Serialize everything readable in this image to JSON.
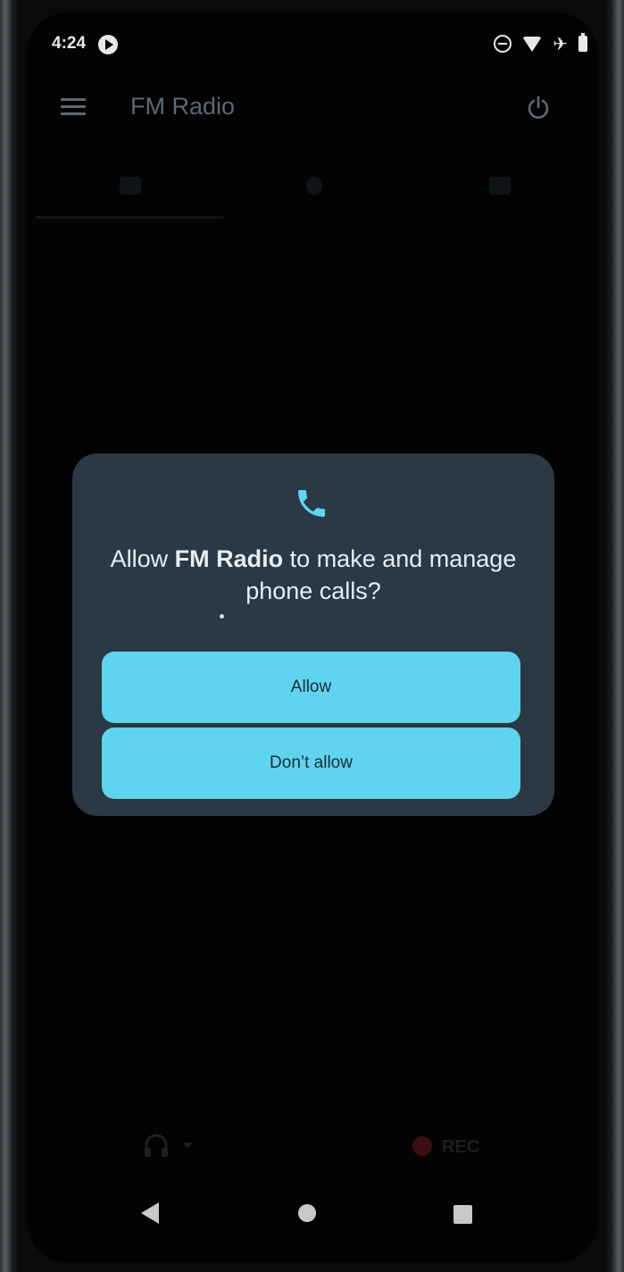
{
  "status_bar": {
    "time": "4:24",
    "icons": [
      "media-play-icon",
      "do-not-disturb-icon",
      "wifi-icon",
      "airplane-mode-icon",
      "battery-icon"
    ]
  },
  "app_bar": {
    "title": "FM Radio",
    "icons": [
      "menu-icon",
      "power-icon"
    ]
  },
  "dialog": {
    "icon": "phone-icon",
    "title_prefix": "Allow ",
    "title_app": "FM Radio",
    "title_suffix": " to make and manage phone calls?",
    "allow_label": "Allow",
    "deny_label": "Don’t allow"
  },
  "bottom_controls": {
    "audio_output_icon": "headphones-icon",
    "rec_label": "REC"
  },
  "nav_bar": {
    "icons": [
      "back-icon",
      "home-icon",
      "recents-icon"
    ]
  },
  "colors": {
    "dialog_background": "#2a3945",
    "button_background": "#5fd4ef",
    "accent": "#5fd4ef",
    "screen_background": "#030303"
  }
}
